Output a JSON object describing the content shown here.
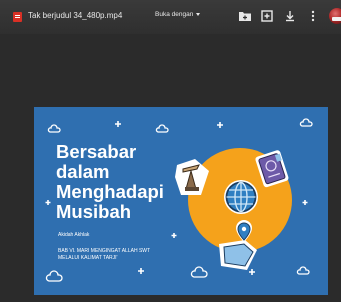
{
  "toolbar": {
    "file_name": "Tak berjudul 34_480p.mp4",
    "open_with_label": "Buka dengan",
    "icons": [
      "add-to-drive-icon",
      "add-shortcut-icon",
      "download-icon",
      "more-options-icon"
    ]
  },
  "slide": {
    "title_lines": [
      "Bersabar",
      "dalam",
      "Menghadapi",
      "Musibah"
    ],
    "author": "Akidah Akhlak",
    "subtitle_lines": [
      "BAB VI. MARI MENGINGAT ALLAH SWT",
      "MELALUI KALIMAT TARJI'"
    ],
    "colors": {
      "background": "#2f6fb0",
      "circle": "#f5a21b",
      "text": "#ffffff"
    }
  }
}
